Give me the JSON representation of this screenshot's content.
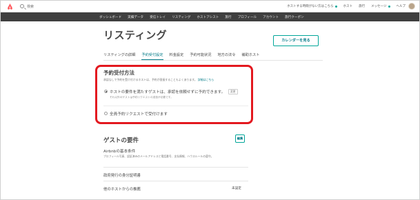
{
  "topbar": {
    "search_placeholder": "検索",
    "notice": "ホストする時間がない方はこちら",
    "links": [
      "ホスト",
      "旅行",
      "メッセージ",
      "ヘルプ"
    ]
  },
  "darknav": {
    "items": [
      "ダッシュボード",
      "実績データ",
      "受信トレイ",
      "リスティング",
      "ホストアシスト",
      "旅行",
      "プロフィール",
      "アカウント",
      "旅行クーポン"
    ]
  },
  "page": {
    "title": "リスティング",
    "calendar_button": "カレンダーを見る"
  },
  "tabs": [
    "リスティングの詳細",
    "予約受付設定",
    "料金設定",
    "予約可能状況",
    "地方の法令",
    "補助ホスト"
  ],
  "active_tab_index": 1,
  "booking": {
    "heading": "予約受付方法",
    "description": "承認なしで予約を受け付けるホストは、予約が直接することもよくあります。",
    "more_link": "詳細はこちら",
    "option1_label": "ホストの要件を満たすゲストは、承認を依頼せずに予約できます。",
    "option1_badge": "変更",
    "option1_sub": "それ以外のゲストは予約リクエストの送信が必要です。",
    "option2_label": "全員予約リクエストで受付けます"
  },
  "guest": {
    "heading": "ゲストの要件",
    "edit_button": "編集",
    "requirements_title": "Airbnbの基本条件",
    "requirements_desc": "プロフィール写真、認証済みのメールアドレスと電話番号、支払情報、ハウスルールの遵守。",
    "row1_label": "政府発行の身分証明書",
    "row2_label": "他のホストからの推薦",
    "row2_value": "未設定"
  },
  "colors": {
    "accent": "#007a87",
    "button_border": "#00a699",
    "highlight": "#e3181f",
    "logo": "#ff5a5f",
    "darknav": "#3f3f3f"
  }
}
